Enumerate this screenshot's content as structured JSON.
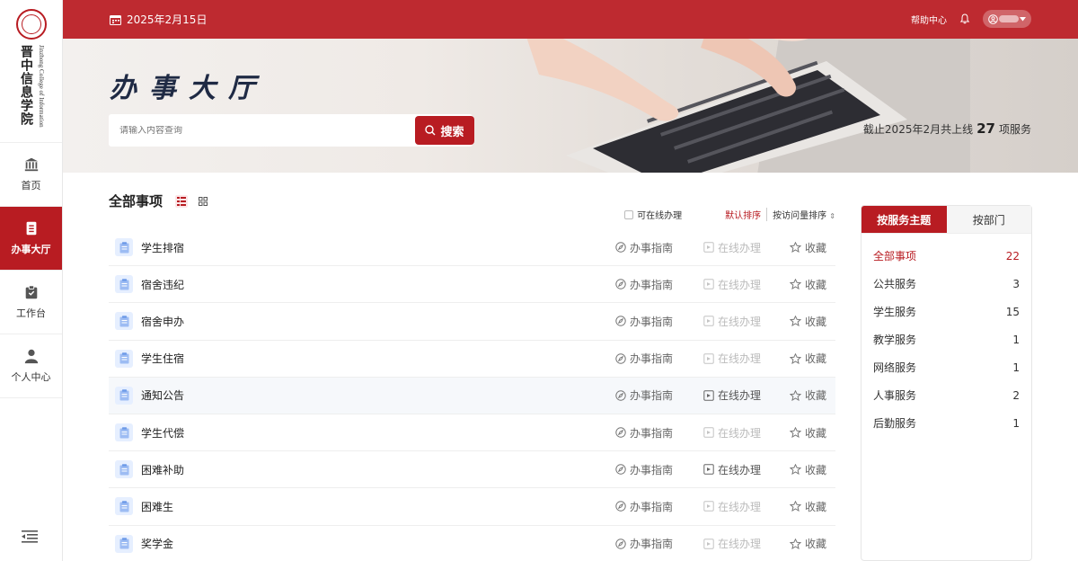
{
  "sidebar": {
    "logo_cn": "晋中信息学院",
    "logo_en": "Jinzhong College of Information",
    "items": [
      {
        "label": "首页",
        "icon": "bank-icon"
      },
      {
        "label": "办事大厅",
        "icon": "document-icon",
        "active": true
      },
      {
        "label": "工作台",
        "icon": "clipboard-icon"
      },
      {
        "label": "个人中心",
        "icon": "person-icon"
      }
    ],
    "collapse_icon": "menu-collapse-icon"
  },
  "header": {
    "date": "2025年2月15日",
    "help": "帮助中心",
    "bell_icon": "bell-icon",
    "user_icon": "user-circle-icon"
  },
  "banner": {
    "title": "办事大厅",
    "search_placeholder": "请输入内容查询",
    "search_button": "搜索",
    "stat_prefix": "截止2025年2月共上线",
    "stat_count": "27",
    "stat_suffix": "项服务"
  },
  "list": {
    "title": "全部事项",
    "online_filter": "可在线办理",
    "sort_default": "默认排序",
    "sort_visits": "按访问量排序",
    "action_guide": "办事指南",
    "action_online": "在线办理",
    "action_fav": "收藏",
    "rows": [
      {
        "name": "学生排宿",
        "online": false
      },
      {
        "name": "宿舍违纪",
        "online": false
      },
      {
        "name": "宿舍申办",
        "online": false
      },
      {
        "name": "学生住宿",
        "online": false
      },
      {
        "name": "通知公告",
        "online": true,
        "highlighted": true
      },
      {
        "name": "学生代偿",
        "online": false
      },
      {
        "name": "困难补助",
        "online": true
      },
      {
        "name": "困难生",
        "online": false
      },
      {
        "name": "奖学金",
        "online": false
      }
    ]
  },
  "panel": {
    "tab_theme": "按服务主题",
    "tab_dept": "按部门",
    "items": [
      {
        "label": "全部事项",
        "count": "22",
        "active": true
      },
      {
        "label": "公共服务",
        "count": "3"
      },
      {
        "label": "学生服务",
        "count": "15"
      },
      {
        "label": "教学服务",
        "count": "1"
      },
      {
        "label": "网络服务",
        "count": "1"
      },
      {
        "label": "人事服务",
        "count": "2"
      },
      {
        "label": "后勤服务",
        "count": "1"
      }
    ]
  },
  "colors": {
    "brand": "#b81c22",
    "header": "#be2a30"
  }
}
